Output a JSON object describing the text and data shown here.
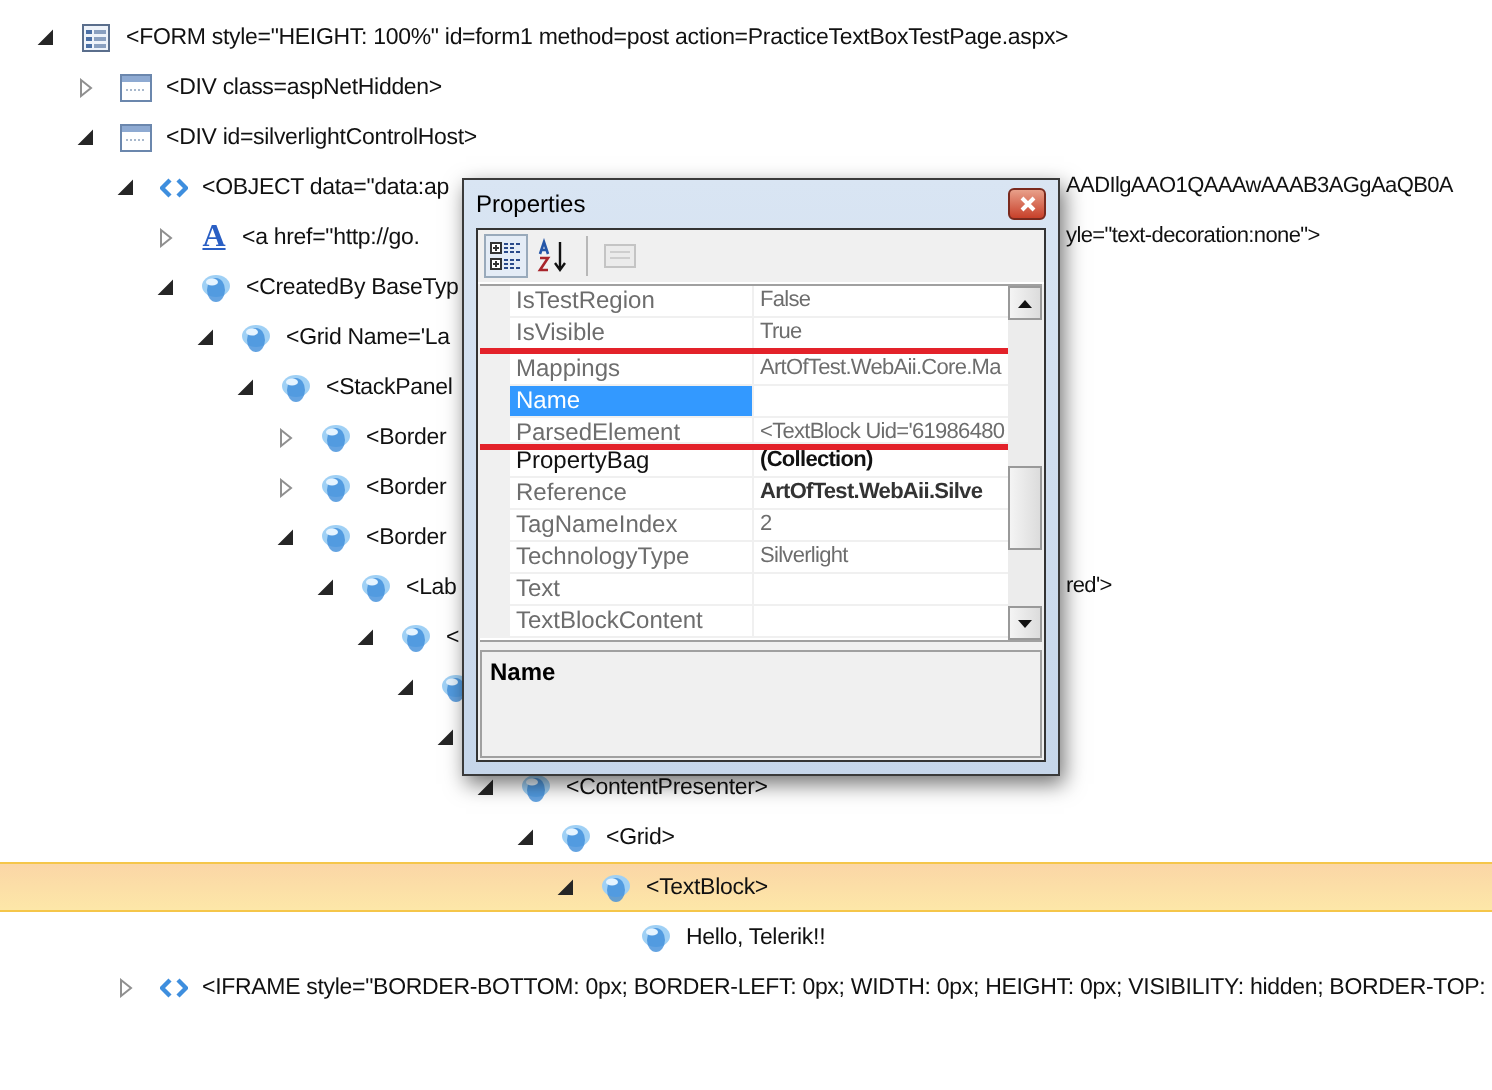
{
  "tree": [
    {
      "label": "<FORM style=\"HEIGHT: 100%\" id=form1 method=post action=PracticeTextBoxTestPage.aspx>",
      "kind": "form",
      "expanded": true,
      "selected": false,
      "children": [
        {
          "label": "<DIV class=aspNetHidden>",
          "kind": "div",
          "expanded": false,
          "selected": false
        },
        {
          "label": "<DIV id=silverlightControlHost>",
          "kind": "div",
          "expanded": true,
          "selected": false,
          "children": [
            {
              "label": "<OBJECT data=\"data:ap",
              "tail": "AADIlgAAO1QAAAwAAAB3AGgAaQB0A",
              "kind": "object",
              "expanded": true,
              "selected": false,
              "children": [
                {
                  "label": "<a href=\"http://go.",
                  "tail": "yle=\"text-decoration:none\">",
                  "kind": "anchor",
                  "glyph": "A",
                  "expanded": false,
                  "selected": false
                },
                {
                  "label": "<CreatedBy BaseTyp",
                  "kind": "silverlight",
                  "expanded": true,
                  "selected": false,
                  "children": [
                    {
                      "label": "<Grid Name='La",
                      "kind": "silverlight",
                      "expanded": true,
                      "selected": false,
                      "children": [
                        {
                          "label": "<StackPanel",
                          "kind": "silverlight",
                          "expanded": true,
                          "selected": false,
                          "children": [
                            {
                              "label": "<Border",
                              "kind": "silverlight",
                              "expanded": false,
                              "selected": false
                            },
                            {
                              "label": "<Border",
                              "kind": "silverlight",
                              "expanded": false,
                              "selected": false
                            },
                            {
                              "label": "<Border",
                              "kind": "silverlight",
                              "expanded": true,
                              "selected": false,
                              "children": [
                                {
                                  "label": "<Lab",
                                  "tail": "red'>",
                                  "kind": "silverlight",
                                  "expanded": true,
                                  "selected": false,
                                  "children": [
                                    {
                                      "label": "<",
                                      "kind": "silverlight",
                                      "expanded": true,
                                      "selected": false,
                                      "children": [
                                        {
                                          "kind": "silverlight",
                                          "expanded": true,
                                          "selected": false,
                                          "children": [
                                            {
                                              "expanded": true,
                                              "children": [
                                                {
                                                  "label": "<ContentPresenter>",
                                                  "kind": "silverlight",
                                                  "expanded": true,
                                                  "selected": false,
                                                  "children": [
                                                    {
                                                      "label": "<Grid>",
                                                      "kind": "silverlight",
                                                      "expanded": true,
                                                      "selected": false,
                                                      "children": [
                                                        {
                                                          "label": "<TextBlock>",
                                                          "kind": "silverlight",
                                                          "expanded": true,
                                                          "selected": true,
                                                          "children": [
                                                            {
                                                              "label": "Hello, Telerik!!",
                                                              "kind": "silverlight",
                                                              "selected": false
                                                            }
                                                          ]
                                                        }
                                                      ]
                                                    }
                                                  ]
                                                }
                                              ]
                                            }
                                          ]
                                        }
                                      ]
                                    }
                                  ]
                                }
                              ]
                            }
                          ]
                        }
                      ]
                    }
                  ]
                }
              ]
            },
            {
              "label": "<IFRAME style=\"BORDER-BOTTOM: 0px; BORDER-LEFT: 0px; WIDTH: 0px; HEIGHT: 0px; VISIBILITY: hidden; BORDER-TOP:",
              "kind": "object",
              "expanded": false,
              "selected": false
            }
          ]
        }
      ]
    }
  ],
  "dialog": {
    "title": "Properties",
    "toolbar": [
      {
        "kind": "categorized",
        "selected": true,
        "disabled": false
      },
      {
        "kind": "alphabetical",
        "selected": false,
        "disabled": false
      },
      {
        "kind": "pages",
        "selected": false,
        "disabled": true
      }
    ],
    "properties": [
      {
        "name": "IsTestRegion",
        "value": "False",
        "readonly": true,
        "bold": false,
        "selected": false,
        "highlighted": false
      },
      {
        "name": "IsVisible",
        "value": "True",
        "readonly": true,
        "bold": false,
        "selected": false,
        "highlighted": false
      },
      {
        "name": "Mappings",
        "value": "ArtOfTest.WebAii.Core.Ma",
        "readonly": true,
        "bold": false,
        "selected": false,
        "highlighted": true
      },
      {
        "name": "Name",
        "readonly": true,
        "bold": false,
        "selected": true,
        "highlighted": true
      },
      {
        "name": "ParsedElement",
        "value": "<TextBlock Uid='61986480",
        "readonly": true,
        "bold": false,
        "selected": false,
        "highlighted": true
      },
      {
        "name": "PropertyBag",
        "value": "(Collection)",
        "readonly": false,
        "bold": true,
        "selected": false,
        "highlighted": false
      },
      {
        "name": "Reference",
        "value": "ArtOfTest.WebAii.Silve",
        "readonly": true,
        "bold": true,
        "selected": false,
        "highlighted": false
      },
      {
        "name": "TagNameIndex",
        "value": "2",
        "readonly": true,
        "bold": false,
        "selected": false,
        "highlighted": false
      },
      {
        "name": "TechnologyType",
        "value": "Silverlight",
        "readonly": true,
        "bold": false,
        "selected": false,
        "highlighted": false
      },
      {
        "name": "Text",
        "readonly": true,
        "bold": false,
        "selected": false,
        "highlighted": false
      },
      {
        "name": "TextBlockContent",
        "readonly": true,
        "bold": false,
        "selected": false,
        "highlighted": false
      }
    ],
    "description": {
      "title": "Name"
    }
  }
}
